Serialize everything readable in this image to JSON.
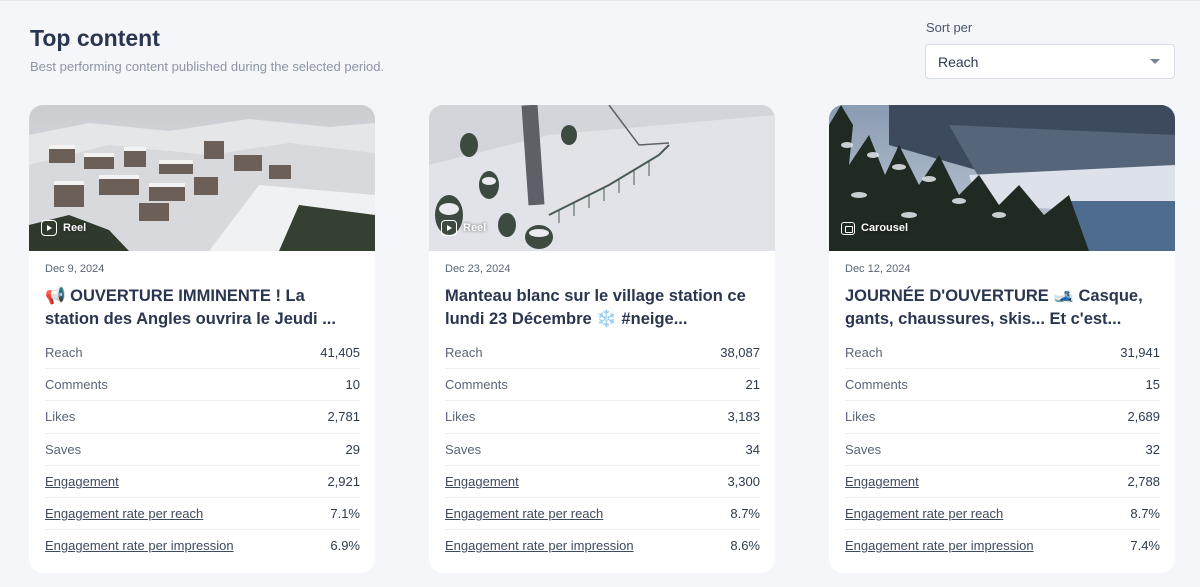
{
  "header": {
    "title": "Top content",
    "subtitle": "Best performing content published during the selected period."
  },
  "sort": {
    "label": "Sort per",
    "selected": "Reach"
  },
  "stat_labels": {
    "reach": "Reach",
    "comments": "Comments",
    "likes": "Likes",
    "saves": "Saves",
    "engagement": "Engagement",
    "er_reach": "Engagement rate per reach",
    "er_impression": "Engagement rate per impression"
  },
  "cards": [
    {
      "type": "Reel",
      "type_icon": "reel-icon",
      "date": "Dec 9, 2024",
      "title": "📢 OUVERTURE IMMINENTE ! La station des Angles ouvrira le Jeudi ...",
      "reach": "41,405",
      "comments": "10",
      "likes": "2,781",
      "saves": "29",
      "engagement": "2,921",
      "er_reach": "7.1%",
      "er_impression": "6.9%"
    },
    {
      "type": "Reel",
      "type_icon": "reel-icon",
      "date": "Dec 23, 2024",
      "title": "Manteau blanc sur le village station ce lundi 23 Décembre ❄️ #neige...",
      "reach": "38,087",
      "comments": "21",
      "likes": "3,183",
      "saves": "34",
      "engagement": "3,300",
      "er_reach": "8.7%",
      "er_impression": "8.6%"
    },
    {
      "type": "Carousel",
      "type_icon": "carousel-icon",
      "date": "Dec 12, 2024",
      "title": "JOURNÉE D'OUVERTURE 🎿 Casque, gants, chaussures, skis... Et c'est...",
      "reach": "31,941",
      "comments": "15",
      "likes": "2,689",
      "saves": "32",
      "engagement": "2,788",
      "er_reach": "8.7%",
      "er_impression": "7.4%"
    }
  ]
}
